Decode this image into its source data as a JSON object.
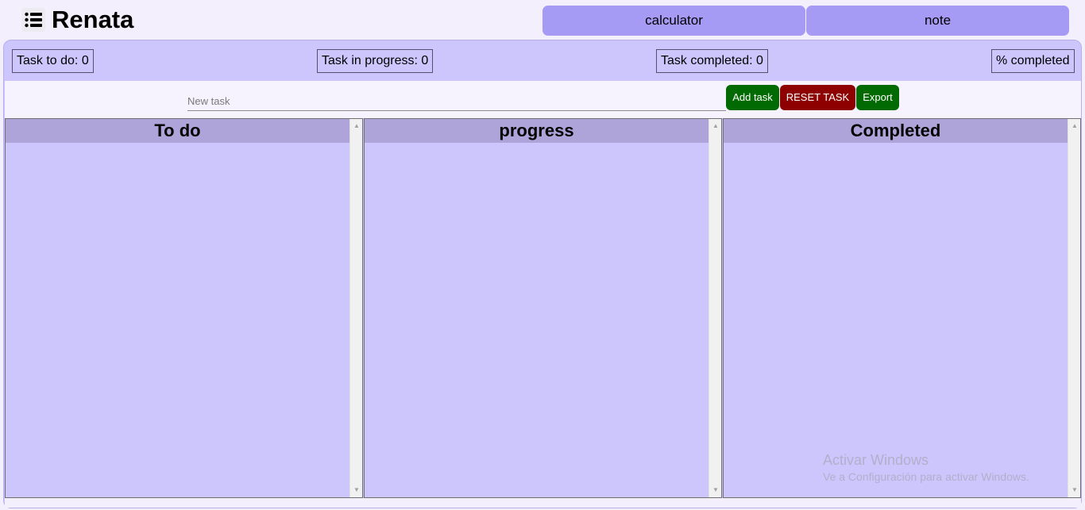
{
  "header": {
    "app_title": "Renata",
    "menu_icon": "list-icon",
    "nav": {
      "calculator_label": "calculator",
      "note_label": "note"
    }
  },
  "stats": {
    "todo": "Task to do: 0",
    "in_progress": "Task in progress: 0",
    "completed": "Task completed: 0",
    "percent": "% completed"
  },
  "task_entry": {
    "placeholder": "New task",
    "add_label": "Add task",
    "reset_label": "RESET TASK",
    "export_label": "Export"
  },
  "columns": [
    {
      "title": "To do"
    },
    {
      "title": "progress"
    },
    {
      "title": "Completed"
    }
  ],
  "watermark": {
    "title": "Activar Windows",
    "subtitle": "Ve a Configuración para activar Windows."
  },
  "colors": {
    "accent": "#a59bf5",
    "panel": "#ccc6fd",
    "column_header": "#aea4da",
    "add_button": "#026a02",
    "reset_button": "#8e0000"
  }
}
